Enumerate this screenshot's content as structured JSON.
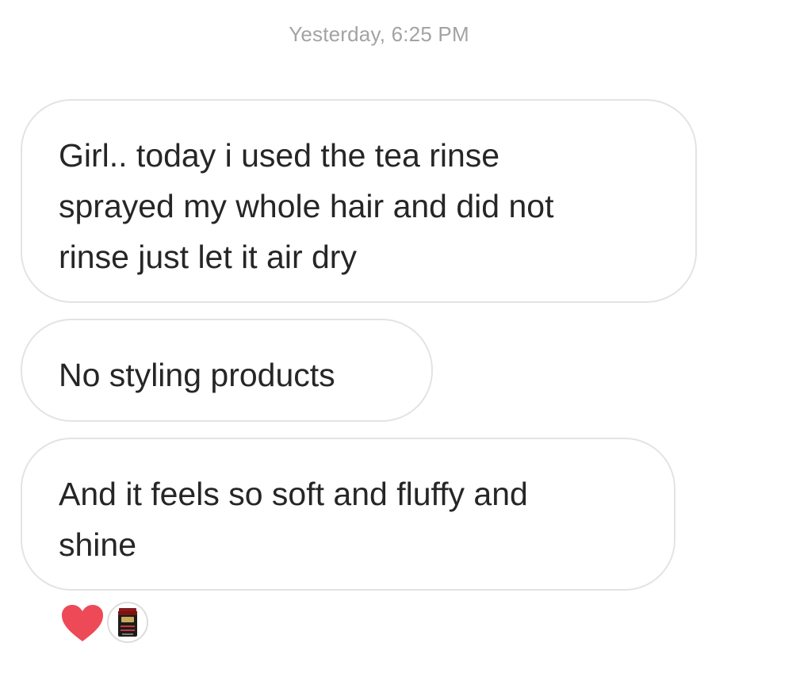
{
  "thread": {
    "timestamp": "Yesterday, 6:25 PM",
    "messages": [
      {
        "lines": [
          "Girl.. today i used the tea rinse",
          "sprayed my whole hair and did not",
          "rinse just let it air dry"
        ]
      },
      {
        "lines": [
          "No styling products"
        ]
      },
      {
        "lines": [
          "And it feels so soft and fluffy and",
          "shine"
        ]
      }
    ],
    "reaction": {
      "emoji_icon": "heart-icon",
      "color": "#ed4956"
    }
  }
}
